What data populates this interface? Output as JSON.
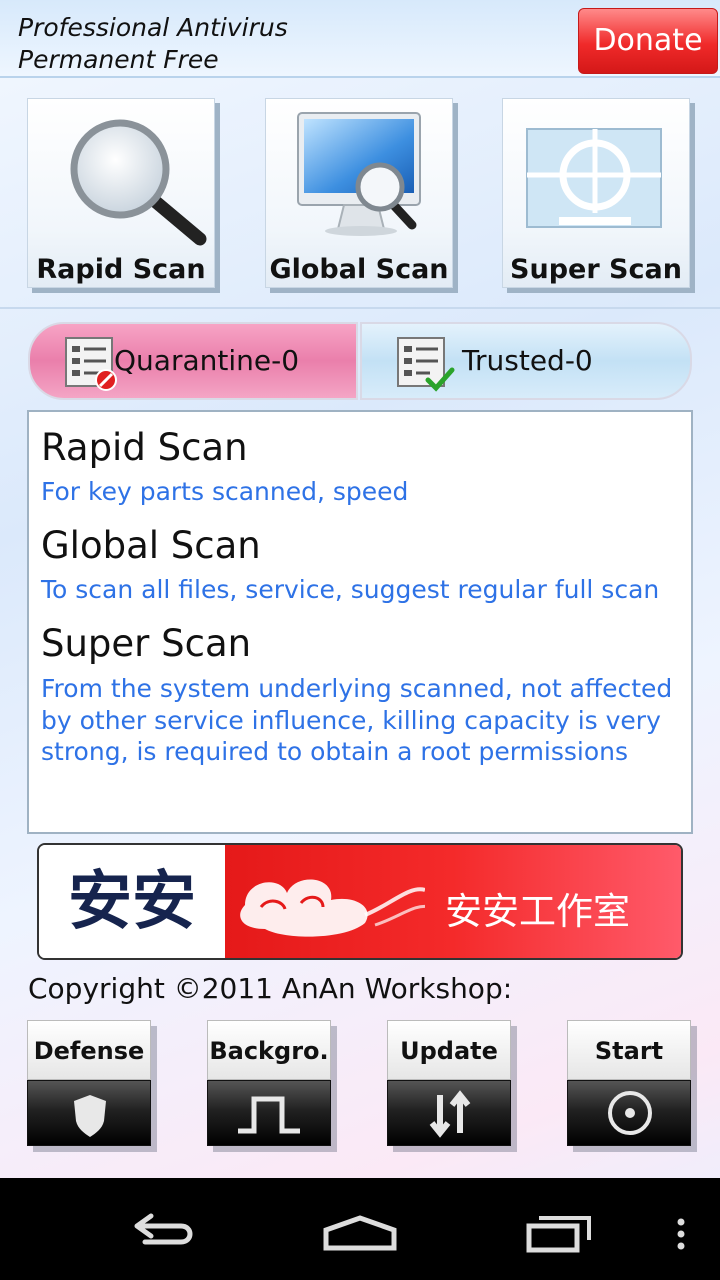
{
  "header": {
    "title": "Professional Antivirus\nPermanent Free",
    "donate_label": "Donate"
  },
  "scan_tiles": [
    {
      "label": "Rapid Scan",
      "icon": "magnifier-icon"
    },
    {
      "label": "Global Scan",
      "icon": "monitor-magnifier-icon"
    },
    {
      "label": "Super Scan",
      "icon": "crosshair-icon"
    }
  ],
  "lists": {
    "quarantine_label": "Quarantine-0",
    "trusted_label": "Trusted-0"
  },
  "info": [
    {
      "title": "Rapid Scan",
      "desc": "For key parts scanned, speed"
    },
    {
      "title": "Global Scan",
      "desc": "To scan all files, service, suggest regular full scan"
    },
    {
      "title": "Super Scan",
      "desc": "From the system underlying scanned, not affected by other service influence, killing capacity is very strong, is required to obtain a root permissions"
    }
  ],
  "banner": {
    "logo_text": "安安",
    "studio_text": "安安工作室"
  },
  "copyright": "Copyright ©2011 AnAn Workshop:",
  "actions": [
    {
      "label": "Defense",
      "icon": "shield-icon"
    },
    {
      "label": "Backgro.",
      "icon": "pulse-icon"
    },
    {
      "label": "Update",
      "icon": "up-down-arrows-icon"
    },
    {
      "label": "Start",
      "icon": "target-icon"
    }
  ],
  "colors": {
    "donate": "#f02a2a",
    "quarantine_bg": "#ea7fab",
    "trusted_bg": "#c3e1f5",
    "desc_text": "#2e72e6",
    "banner_red": "#e51919"
  }
}
